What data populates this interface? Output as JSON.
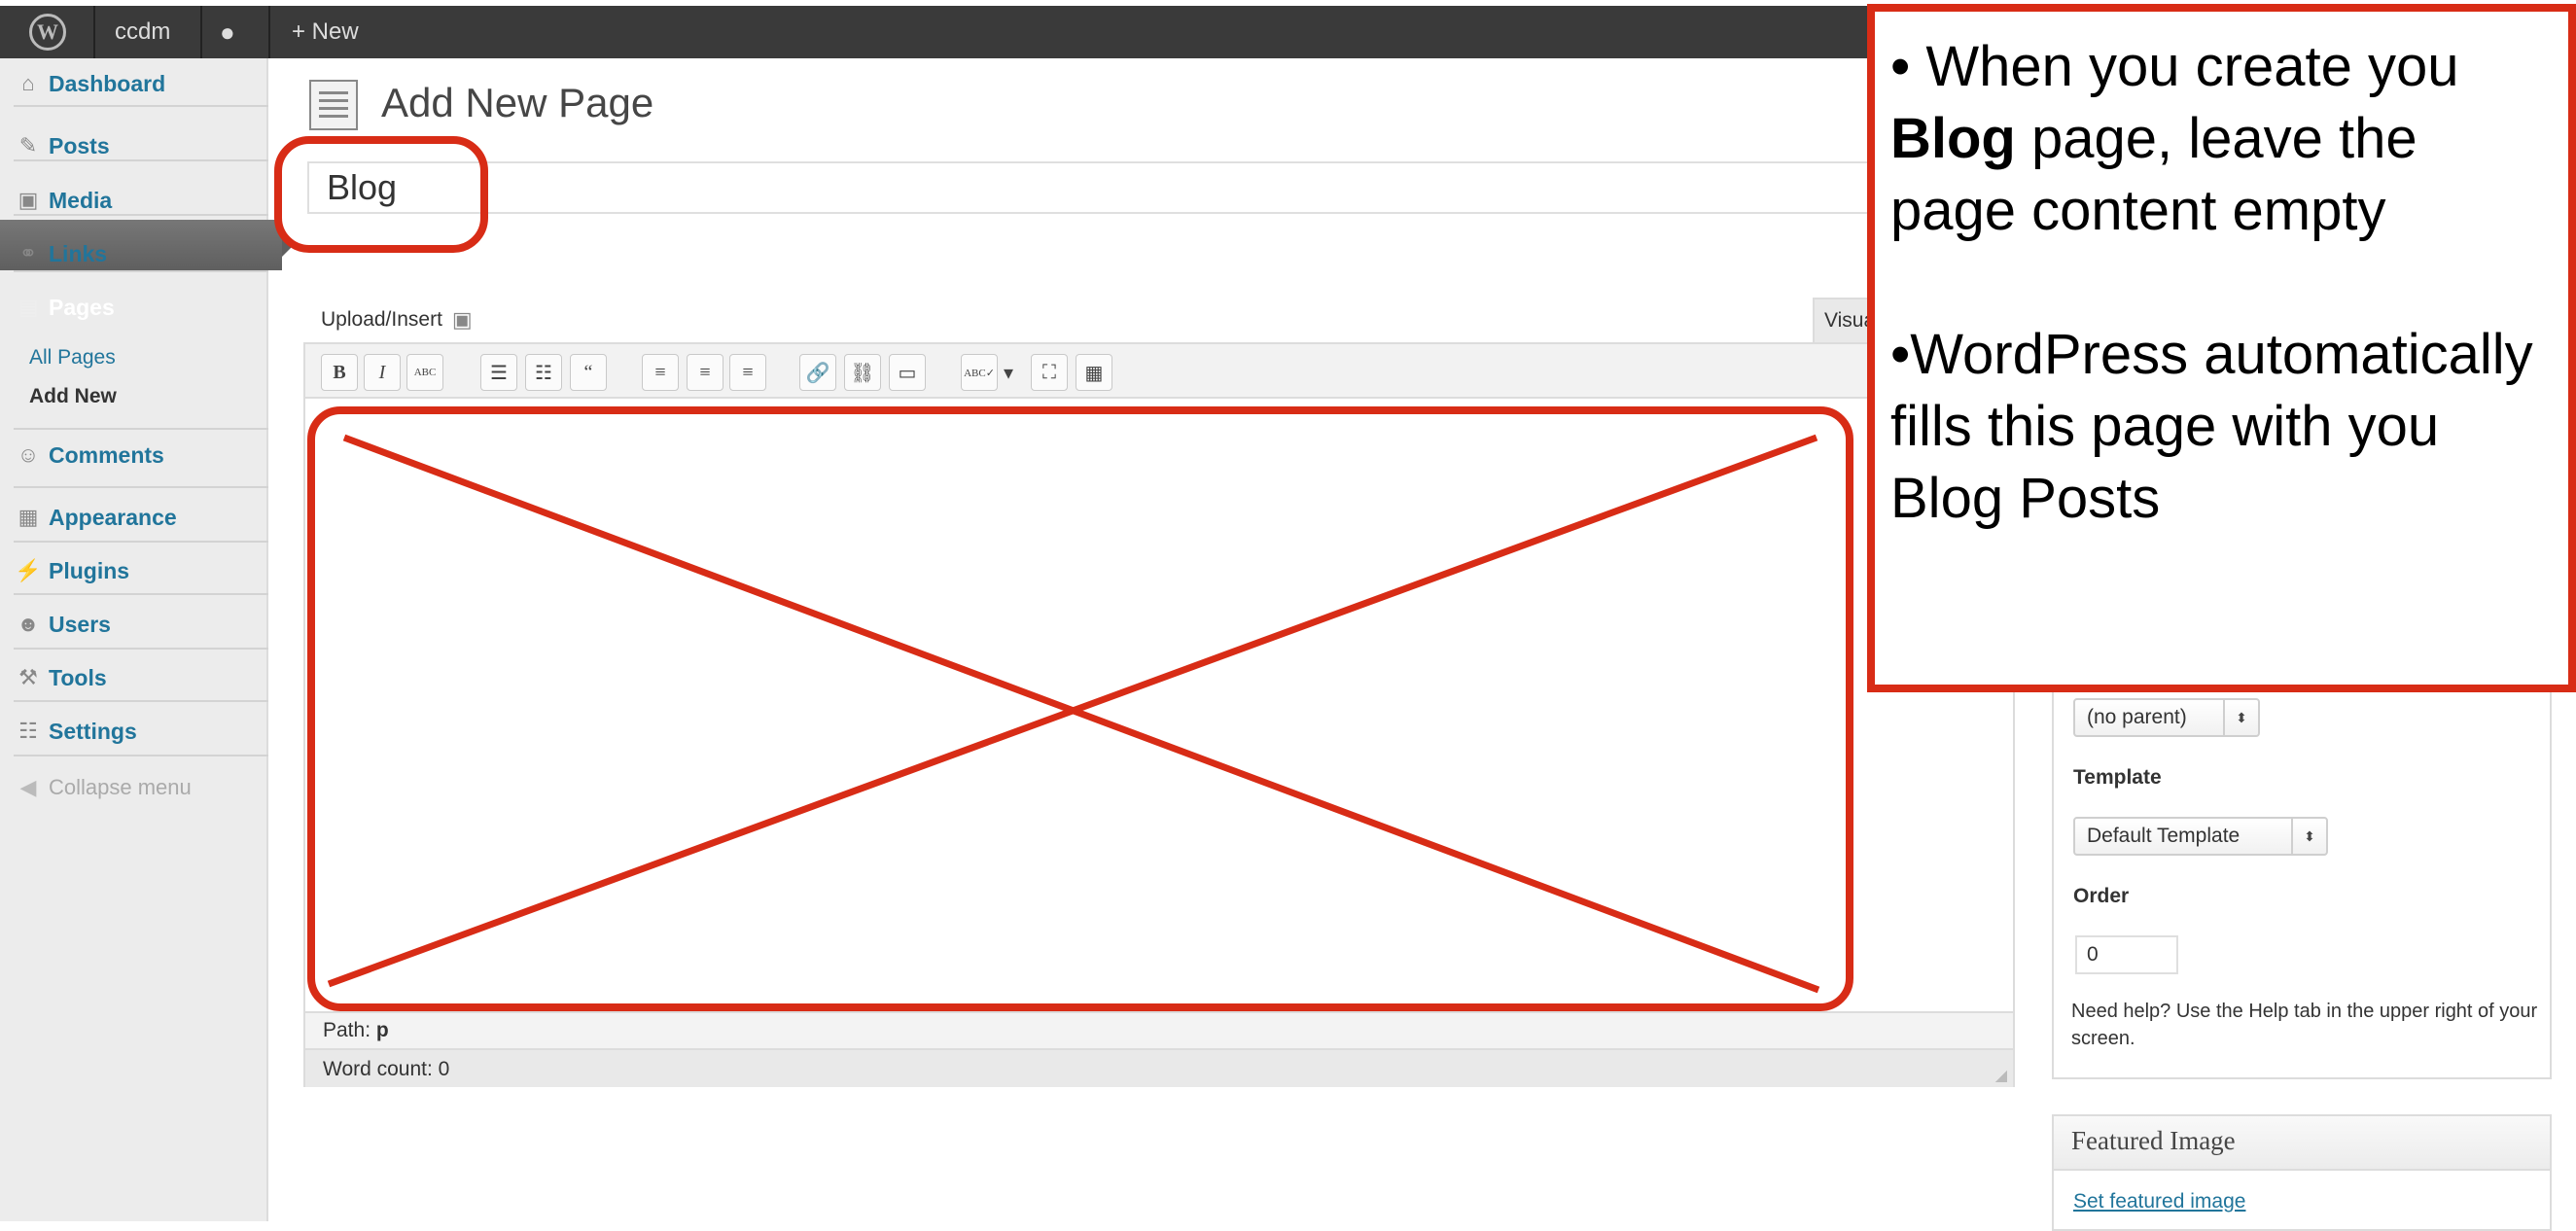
{
  "admin_bar": {
    "site_name": "ccdm",
    "new_label": "+ New"
  },
  "sidebar": {
    "items": [
      {
        "label": "Dashboard",
        "icon": "home-icon",
        "glyph": "⌂"
      },
      {
        "label": "Posts",
        "icon": "pushpin-icon",
        "glyph": "✎"
      },
      {
        "label": "Media",
        "icon": "media-icon",
        "glyph": "▣"
      },
      {
        "label": "Links",
        "icon": "link-icon",
        "glyph": "⚭"
      },
      {
        "label": "Pages",
        "icon": "pages-icon",
        "glyph": "▤"
      },
      {
        "label": "Comments",
        "icon": "comment-icon",
        "glyph": "☺"
      },
      {
        "label": "Appearance",
        "icon": "appearance-icon",
        "glyph": "▦"
      },
      {
        "label": "Plugins",
        "icon": "plugin-icon",
        "glyph": "⚡"
      },
      {
        "label": "Users",
        "icon": "users-icon",
        "glyph": "☻"
      },
      {
        "label": "Tools",
        "icon": "tools-icon",
        "glyph": "⚒"
      },
      {
        "label": "Settings",
        "icon": "settings-icon",
        "glyph": "☷"
      }
    ],
    "submenu": {
      "all_pages": "All Pages",
      "add_new": "Add New"
    },
    "collapse": "Collapse menu"
  },
  "main": {
    "heading": "Add New Page",
    "title_value": "Blog",
    "upload_insert": "Upload/Insert",
    "visual_tab": "Visual",
    "path_label": "Path:",
    "path_value": "p",
    "word_count": "Word count: 0"
  },
  "toolbar": [
    "B",
    "I",
    "ABC",
    "☰",
    "☷",
    "“",
    "≡",
    "≡",
    "≡",
    "🔗",
    "⛓",
    "▭",
    "ABC✓",
    "▾",
    "⛶",
    "▦"
  ],
  "attributes": {
    "parent_select": "(no parent)",
    "template_label": "Template",
    "template_select": "Default Template",
    "order_label": "Order",
    "order_value": "0",
    "help": "Need help? Use the Help tab in the upper right of your screen."
  },
  "featured": {
    "title": "Featured Image",
    "link": "Set featured image"
  },
  "callout": {
    "p1_prefix": "• When you create you ",
    "p1_bold": "Blog",
    "p1_suffix": " page, leave the page content empty",
    "p2": "•WordPress automatically fills this page with you Blog Posts"
  },
  "colors": {
    "annotation": "#d82c16",
    "link": "#21759b",
    "adminbar": "#3a3a3a"
  }
}
